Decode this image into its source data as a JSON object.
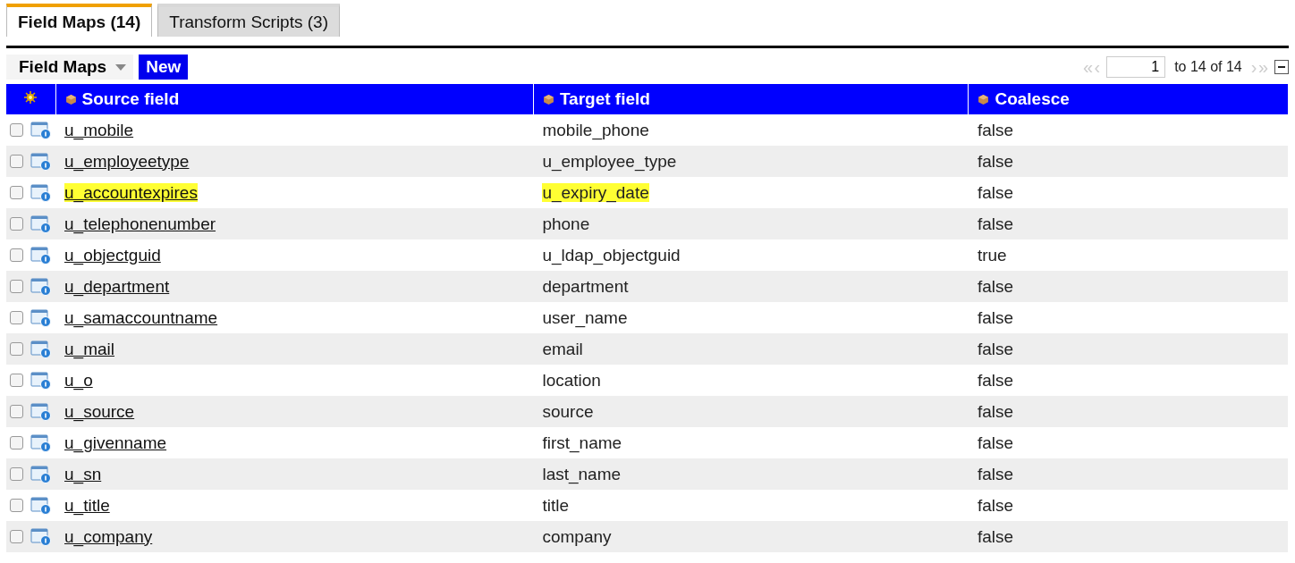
{
  "tabs": [
    {
      "label": "Field Maps (14)",
      "selected": true
    },
    {
      "label": "Transform Scripts (3)",
      "selected": false
    }
  ],
  "toolbar": {
    "list_title": "Field Maps",
    "new_button": "New",
    "pager": {
      "first": "«",
      "prev": "‹",
      "page": "1",
      "range": "to 14 of 14",
      "next": "›",
      "last": "»"
    }
  },
  "table": {
    "columns": [
      "Source field",
      "Target field",
      "Coalesce"
    ],
    "rows": [
      {
        "source": "u_mobile",
        "target": "mobile_phone",
        "coalesce": "false",
        "checked": false,
        "highlighted": false
      },
      {
        "source": "u_employeetype",
        "target": "u_employee_type",
        "coalesce": "false",
        "checked": false,
        "highlighted": false
      },
      {
        "source": "u_accountexpires",
        "target": "u_expiry_date",
        "coalesce": "false",
        "checked": false,
        "highlighted": true
      },
      {
        "source": "u_telephonenumber",
        "target": "phone",
        "coalesce": "false",
        "checked": false,
        "highlighted": false
      },
      {
        "source": "u_objectguid",
        "target": "u_ldap_objectguid",
        "coalesce": "true",
        "checked": false,
        "highlighted": false
      },
      {
        "source": "u_department",
        "target": "department",
        "coalesce": "false",
        "checked": false,
        "highlighted": false
      },
      {
        "source": "u_samaccountname",
        "target": "user_name",
        "coalesce": "false",
        "checked": false,
        "highlighted": false
      },
      {
        "source": "u_mail",
        "target": "email",
        "coalesce": "false",
        "checked": false,
        "highlighted": false
      },
      {
        "source": "u_o",
        "target": "location",
        "coalesce": "false",
        "checked": false,
        "highlighted": false
      },
      {
        "source": "u_source",
        "target": "source",
        "coalesce": "false",
        "checked": false,
        "highlighted": false
      },
      {
        "source": "u_givenname",
        "target": "first_name",
        "coalesce": "false",
        "checked": false,
        "highlighted": false
      },
      {
        "source": "u_sn",
        "target": "last_name",
        "coalesce": "false",
        "checked": false,
        "highlighted": false
      },
      {
        "source": "u_title",
        "target": "title",
        "coalesce": "false",
        "checked": false,
        "highlighted": false
      },
      {
        "source": "u_company",
        "target": "company",
        "coalesce": "false",
        "checked": false,
        "highlighted": false
      }
    ]
  }
}
